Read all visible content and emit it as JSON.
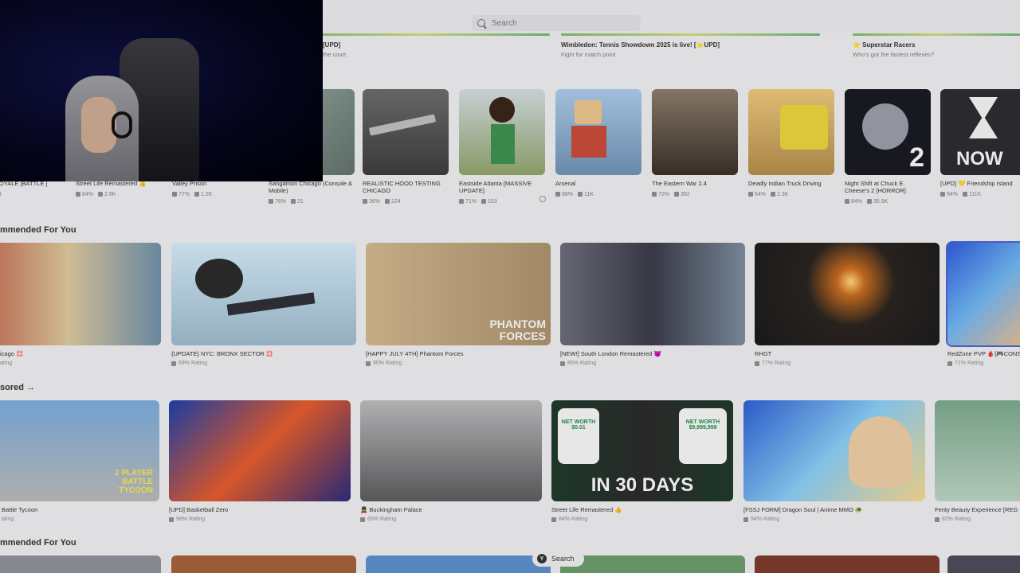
{
  "search": {
    "placeholder": "Search"
  },
  "events": [
    {
      "title": "[UPD]",
      "sub": "the court"
    },
    {
      "title": "Wimbledon: Tennis Showdown 2025 is live! [⭐UPD]",
      "sub": "Fight for match point"
    },
    {
      "title": "⭐ Superstar Racers",
      "sub": "Who's got the fastest reflexes?"
    }
  ],
  "row1": [
    {
      "name": "R ROYALE [BATTLE ]",
      "likes": "",
      "players": "23"
    },
    {
      "name": "Street Life Remastered 👍",
      "likes": "84%",
      "players": "2.6K"
    },
    {
      "name": "Valley Prison",
      "likes": "77%",
      "players": "1.2K"
    },
    {
      "name": "Sangamon Chicago (Console & Mobile)",
      "likes": "76%",
      "players": "21"
    },
    {
      "name": "REALISTIC HOOD TESTING CHICAGO",
      "likes": "36%",
      "players": "224"
    },
    {
      "name": "Eastside Atlanta [MASSIVE UPDATE]",
      "likes": "71%",
      "players": "153"
    },
    {
      "name": "Arsenal",
      "likes": "88%",
      "players": "11K"
    },
    {
      "name": "The Eastern War 2.4",
      "likes": "72%",
      "players": "382"
    },
    {
      "name": "Deadly Indian Truck Driving",
      "likes": "64%",
      "players": "2.3K"
    },
    {
      "name": "Night Shift at Chuck E. Cheese's 2 [HORROR]",
      "likes": "84%",
      "players": "35.5K"
    },
    {
      "name": "[UPD] 💛 Friendship Island",
      "likes": "94%",
      "players": "111K"
    }
  ],
  "sections": {
    "recommended1": "mmended For You",
    "sponsored": "sored →",
    "recommended2": "mmended For You"
  },
  "row2": [
    {
      "name": "icago 💢",
      "rating": "ating"
    },
    {
      "name": "{UPDATE} NYC: BRONX SECTOR 💢",
      "rating": "69% Rating"
    },
    {
      "name": "[HAPPY JULY 4TH] Phantom Forces",
      "rating": "90% Rating"
    },
    {
      "name": "[NEW!] South London Remastered 😈",
      "rating": "85% Rating"
    },
    {
      "name": "RHGT",
      "rating": "77% Rating"
    },
    {
      "name": "RedZone PVP 🩸[🎮CONS",
      "rating": "71% Rating"
    }
  ],
  "row3": [
    {
      "name": "Battle Tycoon",
      "rating": "ating"
    },
    {
      "name": "[UPD] Basketball Zero",
      "rating": "98% Rating"
    },
    {
      "name": "💂 Buckingham Palace",
      "rating": "65% Rating"
    },
    {
      "name": "Street Life Remastered 👍",
      "rating": "84% Rating"
    },
    {
      "name": "[FSSJ FORM] Dragon Soul | Anime MMO 🐢",
      "rating": "94% Rating"
    },
    {
      "name": "Fenty Beauty Experience [REG",
      "rating": "82% Rating"
    }
  ],
  "thumb_text": {
    "now": "NOW",
    "two": "2",
    "in30": "IN 30 DAYS",
    "phantom": "PHANTOM FORCES",
    "player2": "2 PLAYER BATTLE TYCOON",
    "networth1": "NET WORTH $0.01",
    "networth2": "NET WORTH $9,999,999"
  },
  "pill": {
    "label": "Search",
    "key": "Y"
  }
}
